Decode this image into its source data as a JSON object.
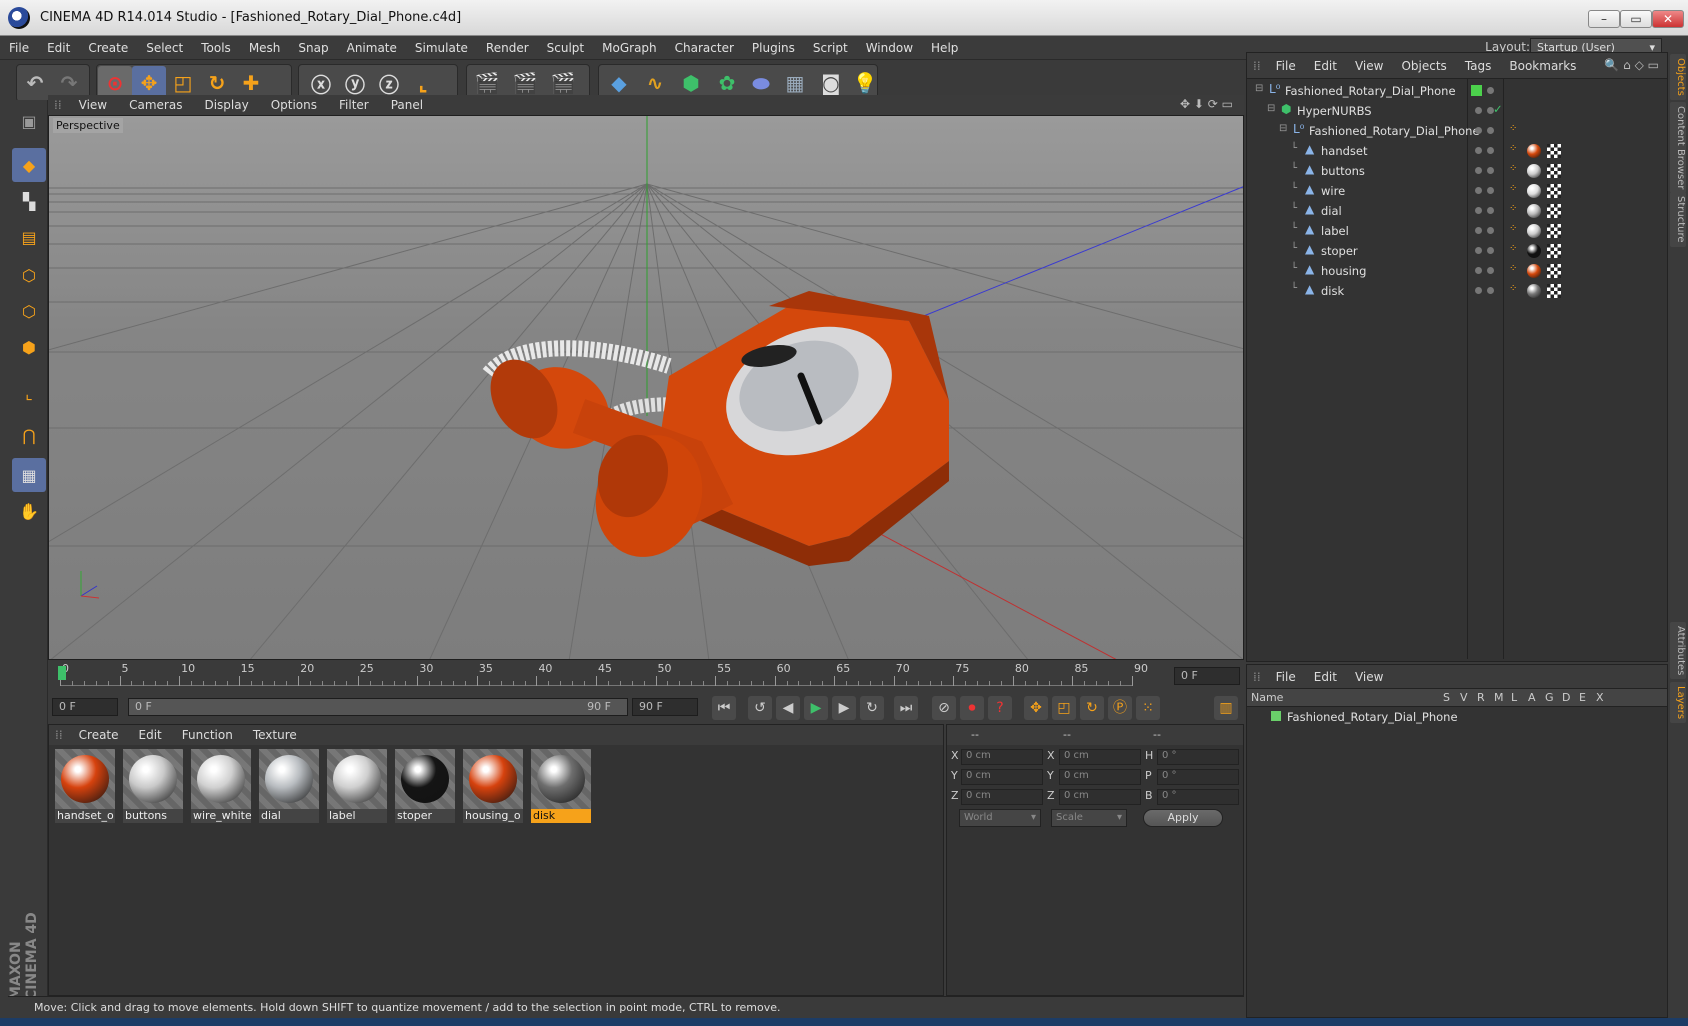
{
  "window": {
    "title": "CINEMA 4D R14.014 Studio - [Fashioned_Rotary_Dial_Phone.c4d]"
  },
  "menu": [
    "File",
    "Edit",
    "Create",
    "Select",
    "Tools",
    "Mesh",
    "Snap",
    "Animate",
    "Simulate",
    "Render",
    "Sculpt",
    "MoGraph",
    "Character",
    "Plugins",
    "Script",
    "Window",
    "Help"
  ],
  "layout": {
    "label": "Layout:",
    "value": "Startup (User)"
  },
  "viewport": {
    "menu": [
      "View",
      "Cameras",
      "Display",
      "Options",
      "Filter",
      "Panel"
    ],
    "label": "Perspective"
  },
  "timeline": {
    "ticks": [
      "0",
      "5",
      "10",
      "15",
      "20",
      "25",
      "30",
      "35",
      "40",
      "45",
      "50",
      "55",
      "60",
      "65",
      "70",
      "75",
      "80",
      "85",
      "90"
    ],
    "current_frame": "0 F",
    "start": "0 F",
    "range_start": "0 F",
    "range_end": "90 F",
    "end": "90 F"
  },
  "materials": {
    "menu": [
      "Create",
      "Edit",
      "Function",
      "Texture"
    ],
    "items": [
      {
        "name": "handset_o",
        "color": "#d6420e"
      },
      {
        "name": "buttons",
        "color": "#c9c9c9"
      },
      {
        "name": "wire_white",
        "color": "#d0d0d0"
      },
      {
        "name": "dial",
        "color": "#b8bcc0"
      },
      {
        "name": "label",
        "color": "#cfcfcf"
      },
      {
        "name": "stoper",
        "color": "#151515"
      },
      {
        "name": "housing_o",
        "color": "#d6420e"
      },
      {
        "name": "disk",
        "color": "#6e6e6e"
      }
    ]
  },
  "coords": {
    "headers": [
      "--",
      "--",
      "--"
    ],
    "rows": [
      {
        "a": "X",
        "v1": "0 cm",
        "b": "X",
        "v2": "0 cm",
        "c": "H",
        "v3": "0 °"
      },
      {
        "a": "Y",
        "v1": "0 cm",
        "b": "Y",
        "v2": "0 cm",
        "c": "P",
        "v3": "0 °"
      },
      {
        "a": "Z",
        "v1": "0 cm",
        "b": "Z",
        "v2": "0 cm",
        "c": "B",
        "v3": "0 °"
      }
    ],
    "world": "World",
    "scale": "Scale",
    "apply": "Apply"
  },
  "objects": {
    "menu": [
      "File",
      "Edit",
      "View",
      "Objects",
      "Tags",
      "Bookmarks"
    ],
    "tree": [
      {
        "name": "Fashioned_Rotary_Dial_Phone",
        "indent": 0
      },
      {
        "name": "HyperNURBS",
        "indent": 1
      },
      {
        "name": "Fashioned_Rotary_Dial_Phone",
        "indent": 2
      },
      {
        "name": "handset",
        "indent": 3
      },
      {
        "name": "buttons",
        "indent": 3
      },
      {
        "name": "wire",
        "indent": 3
      },
      {
        "name": "dial",
        "indent": 3
      },
      {
        "name": "label",
        "indent": 3
      },
      {
        "name": "stoper",
        "indent": 3
      },
      {
        "name": "housing",
        "indent": 3
      },
      {
        "name": "disk",
        "indent": 3
      }
    ]
  },
  "layers": {
    "menu": [
      "File",
      "Edit",
      "View"
    ],
    "header_name": "Name",
    "header_cols": [
      "S",
      "V",
      "R",
      "M",
      "L",
      "A",
      "G",
      "D",
      "E",
      "X"
    ],
    "row": "Fashioned_Rotary_Dial_Phone"
  },
  "side_tabs": [
    "Objects",
    "Content Browser",
    "Structure",
    "Attributes",
    "Layers"
  ],
  "status": "Move: Click and drag to move elements. Hold down SHIFT to quantize movement / add to the selection in point mode, CTRL to remove.",
  "brand": "MAXON CINEMA 4D"
}
